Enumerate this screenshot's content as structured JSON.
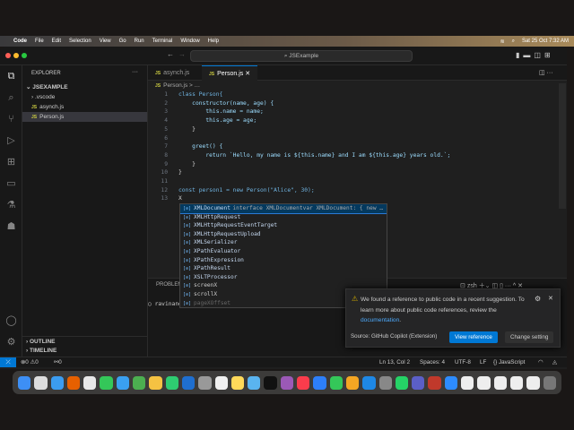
{
  "menubar": {
    "app": "Code",
    "items": [
      "File",
      "Edit",
      "Selection",
      "View",
      "Go",
      "Run",
      "Terminal",
      "Window",
      "Help"
    ],
    "clock": "Sat 25 Oct  7:32 AM"
  },
  "window": {
    "search": "JSExample"
  },
  "sidebar": {
    "title": "EXPLORER",
    "more": "···",
    "project": "JSEXAMPLE",
    "items": [
      {
        "label": ".vscode",
        "type": "folder"
      },
      {
        "label": "asynch.js",
        "type": "js"
      },
      {
        "label": "Person.js",
        "type": "js",
        "selected": true
      }
    ],
    "outline": "OUTLINE",
    "timeline": "TIMELINE"
  },
  "tabs": [
    {
      "label": "asynch.js",
      "active": false
    },
    {
      "label": "Person.js",
      "active": true
    }
  ],
  "breadcrumb": {
    "file": "Person.js",
    "sep": "> …"
  },
  "code": [
    "class Person{",
    "    constructor(name, age) {",
    "        this.name = name;",
    "        this.age = age;",
    "    }",
    "",
    "    greet() {",
    "        return `Hello, my name is ${this.name} and I am ${this.age} years old.`;",
    "    }",
    "}",
    "",
    "const person1 = new Person(\"Alice\", 30);",
    "X"
  ],
  "suggest": {
    "items": [
      "XMLDocument",
      "XMLHttpRequest",
      "XMLHttpRequestEventTarget",
      "XMLHttpRequestUpload",
      "XMLSerializer",
      "XPathEvaluator",
      "XPathExpression",
      "XPathResult",
      "XSLTProcessor",
      "screenX",
      "scrollX",
      "pageXOffset"
    ],
    "detail": "interface XMLDocumentvar XMLDocument: { new …",
    "icon": "[⊘]"
  },
  "panel": {
    "tab": "PROBLEMS",
    "terminal_prompt": "ravinand",
    "shell": "zsh"
  },
  "notification": {
    "text": "We found a reference to public code in a recent suggestion. To learn more about public code references, review the ",
    "link": "documentation",
    "end": ".",
    "source": "Source: GitHub Copilot (Extension)",
    "primary": "View reference",
    "secondary": "Change setting"
  },
  "status": {
    "errors": "0",
    "warnings": "0",
    "ports": "0",
    "position": "Ln 13, Col 2",
    "spaces": "Spaces: 4",
    "encoding": "UTF-8",
    "eol": "LF",
    "language": "JavaScript"
  },
  "colors": {
    "accent": "#0078d4",
    "editor_bg": "#1f1f1f",
    "sidebar_bg": "#181818"
  }
}
